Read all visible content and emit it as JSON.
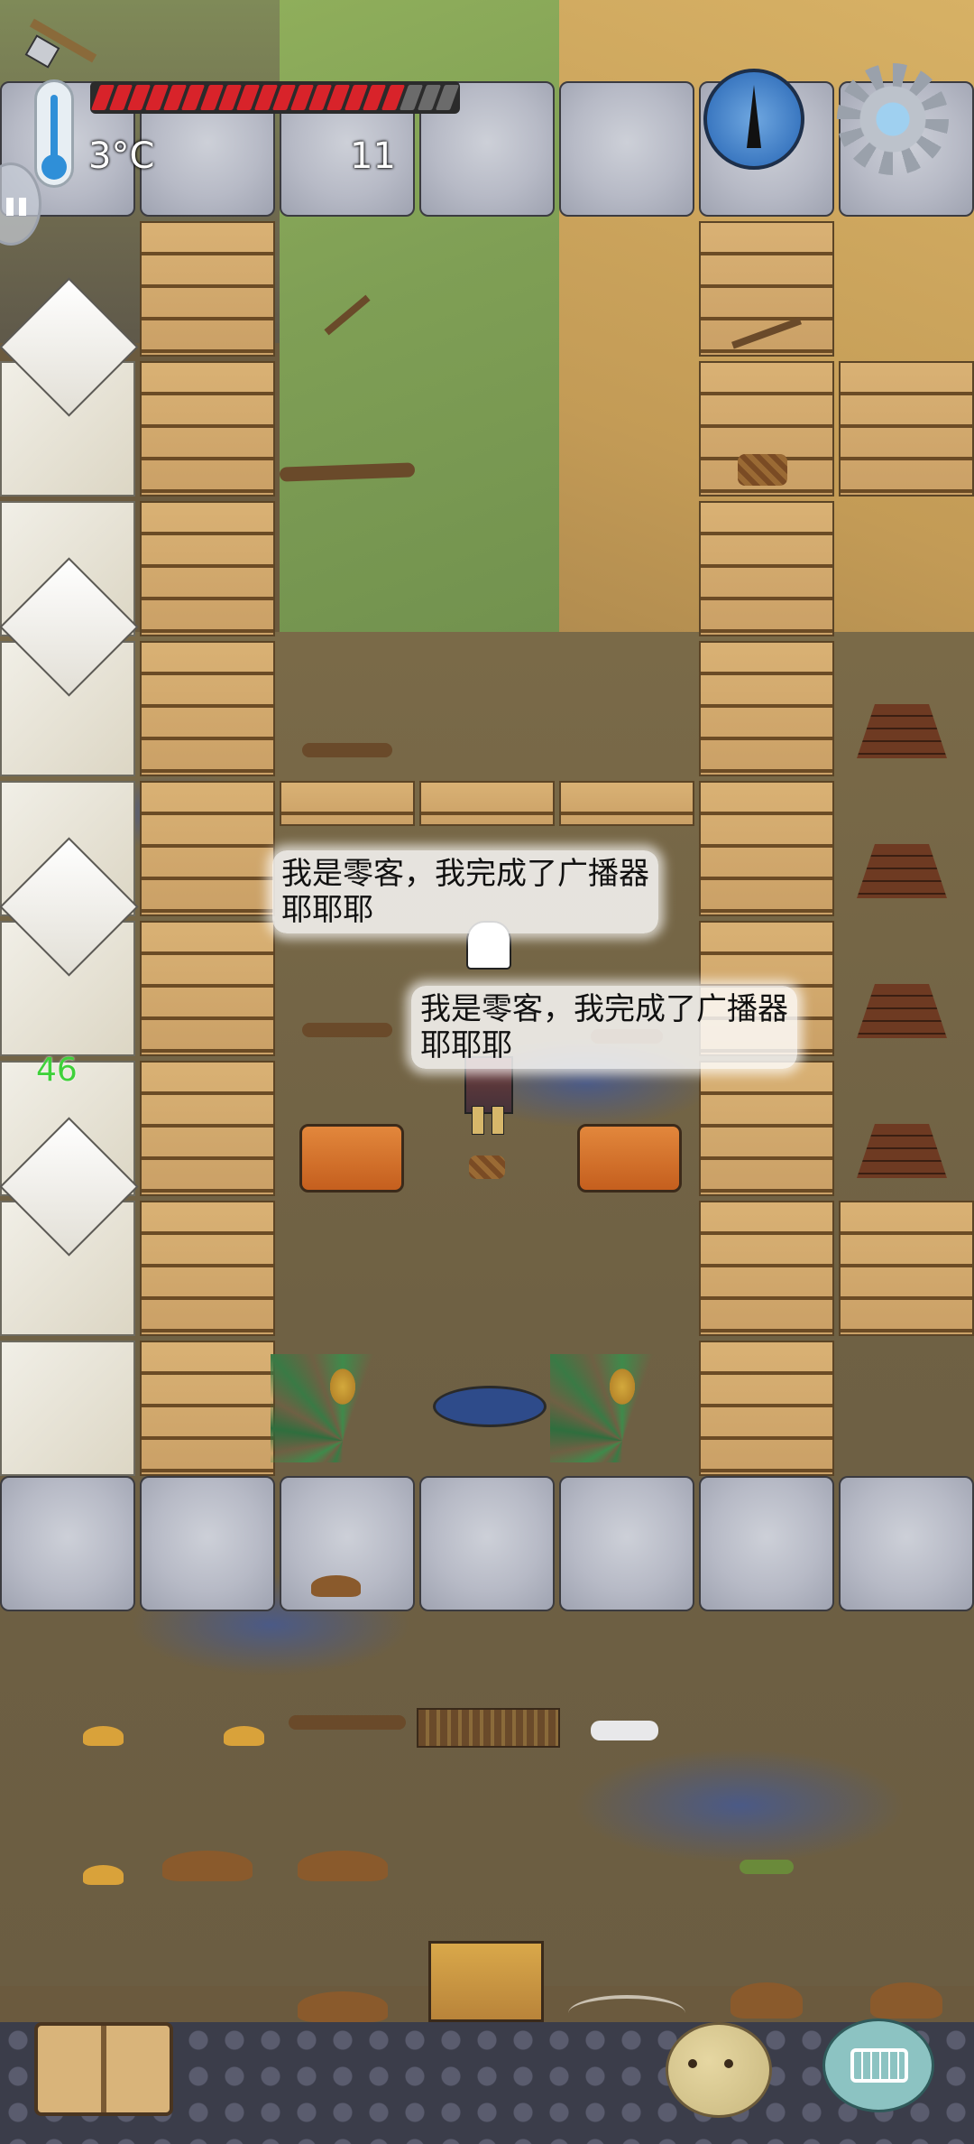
{
  "hud": {
    "temperature": "3°C",
    "item_count": "11",
    "side_number": "46",
    "health_segments_total": 20,
    "health_segments_filled": 17,
    "health_fraction": 0.85
  },
  "speech": [
    {
      "line1": "我是零客，我完成了广播器",
      "line2": "耶耶耶"
    },
    {
      "line1": "我是零客，我完成了广播器",
      "line2": "耶耶耶"
    }
  ],
  "icons": {
    "thermometer": "thermometer-icon",
    "compass": "compass-icon",
    "settings": "gear-icon",
    "pause": "pause-icon",
    "book": "book-icon",
    "emote": "emote-icon",
    "keyboard": "keyboard-icon",
    "held_item": "axe-icon"
  },
  "colors": {
    "health_red": "#d8232a",
    "health_empty": "#6b6b6b",
    "hud_text": "#ffffff",
    "side_number": "#3fd13a",
    "compass_blue": "#3b78c1",
    "keyboard_teal": "#8cc3c2"
  }
}
